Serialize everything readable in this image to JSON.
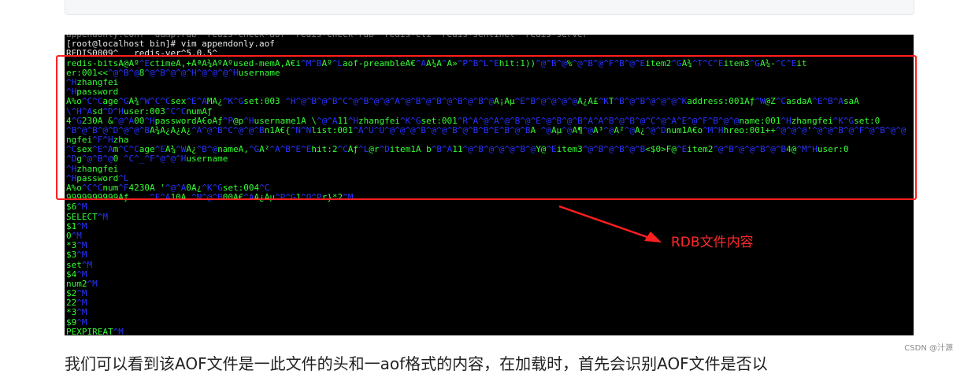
{
  "terminal": {
    "lines": [
      [
        {
          "t": "appendonly.conf  dump.rdb  redis-check-aof  redis-check-rdb  redis-cli  redis-sentinel  redis-server",
          "c": "dim"
        }
      ],
      [
        {
          "t": "[root@localhost bin]# vim appendonly.aof",
          "c": "w"
        }
      ],
      [
        {
          "t": "REDIS0009^   redis-ver^5.0.5^",
          "c": "w"
        }
      ],
      [
        {
          "t": "redis-bitsÃ@Ãº",
          "c": "g"
        },
        {
          "t": "^E",
          "c": "b"
        },
        {
          "t": "ctimeÃ,+ÀªÃ¾ÃºÃºused-memÃ,Ã€i",
          "c": "g"
        },
        {
          "t": "^M^B",
          "c": "b"
        },
        {
          "t": "Ãº",
          "c": "g"
        },
        {
          "t": "^L",
          "c": "b"
        },
        {
          "t": "aof-preambleÃ€",
          "c": "g"
        },
        {
          "t": "^A",
          "c": "b"
        },
        {
          "t": "Ã¾Ã",
          "c": "g"
        },
        {
          "t": "^",
          "c": "b"
        },
        {
          "t": "Ã»",
          "c": "g"
        },
        {
          "t": "^P^B^L^E",
          "c": "b"
        },
        {
          "t": "hit:1))",
          "c": "g"
        },
        {
          "t": "^@^B^@",
          "c": "b"
        },
        {
          "t": "%",
          "c": "g"
        },
        {
          "t": "^@^B^@^F^B^@^E",
          "c": "b"
        },
        {
          "t": "item2",
          "c": "g"
        },
        {
          "t": "^G",
          "c": "b"
        },
        {
          "t": "Ã¾",
          "c": "g"
        },
        {
          "t": "^T^C^E",
          "c": "b"
        },
        {
          "t": "item3",
          "c": "g"
        },
        {
          "t": "^G",
          "c": "b"
        },
        {
          "t": "Ã¾-",
          "c": "g"
        },
        {
          "t": "^C^E",
          "c": "b"
        },
        {
          "t": "it",
          "c": "g"
        }
      ],
      [
        {
          "t": "er:001<<",
          "c": "g"
        },
        {
          "t": "^@^B^@",
          "c": "b"
        },
        {
          "t": "8",
          "c": "g"
        },
        {
          "t": "^@^B^@^@^H^@^@^@^H",
          "c": "b"
        },
        {
          "t": "username",
          "c": "g"
        }
      ],
      [
        {
          "t": "^H",
          "c": "b"
        },
        {
          "t": "zhangfei",
          "c": "g"
        }
      ],
      [
        {
          "t": "^H",
          "c": "b"
        },
        {
          "t": "password",
          "c": "g"
        }
      ],
      [
        {
          "t": "Ã%o",
          "c": "g"
        },
        {
          "t": "^C^C",
          "c": "b"
        },
        {
          "t": "age",
          "c": "g"
        },
        {
          "t": "^G",
          "c": "b"
        },
        {
          "t": "Ã¾",
          "c": "g"
        },
        {
          "t": "^W^C^C",
          "c": "b"
        },
        {
          "t": "sex",
          "c": "g"
        },
        {
          "t": "^E^A",
          "c": "b"
        },
        {
          "t": "MÃ¿",
          "c": "g"
        },
        {
          "t": "^K^G",
          "c": "b"
        },
        {
          "t": "set:003",
          "c": "g"
        },
        {
          "t": " ^H^@^B^@^B^C^@^B^@^@^A^@^B^@^B^@^B^@^B^@",
          "c": "b"
        },
        {
          "t": "Ã¡Ãµ",
          "c": "g"
        },
        {
          "t": "^E^B^@^@^@^@",
          "c": "b"
        },
        {
          "t": "Ã¿Ã£",
          "c": "g"
        },
        {
          "t": "^K",
          "c": "b"
        },
        {
          "t": "T",
          "c": "g"
        },
        {
          "t": "^B^@^B^@^@^@^K",
          "c": "b"
        },
        {
          "t": "address:001Ãƒ",
          "c": "g"
        },
        {
          "t": "^W",
          "c": "b"
        },
        {
          "t": "@Z",
          "c": "g"
        },
        {
          "t": "^C",
          "c": "b"
        },
        {
          "t": "asdaÃ",
          "c": "g"
        },
        {
          "t": "^E^B^A",
          "c": "b"
        },
        {
          "t": "saÃ",
          "c": "g"
        }
      ],
      [
        {
          "t": "\\^H^A",
          "c": "b"
        },
        {
          "t": "sd",
          "c": "g"
        },
        {
          "t": "^D^H",
          "c": "b"
        },
        {
          "t": "user:003",
          "c": "g"
        },
        {
          "t": "^C^C",
          "c": "b"
        },
        {
          "t": "numÃƒ",
          "c": "g"
        }
      ],
      [
        {
          "t": "4",
          "c": "g"
        },
        {
          "t": "^G",
          "c": "b"
        },
        {
          "t": "230Ã &",
          "c": "g"
        },
        {
          "t": "^@^A",
          "c": "b"
        },
        {
          "t": "00",
          "c": "g"
        },
        {
          "t": "^H",
          "c": "b"
        },
        {
          "t": "passwordÃ€oÃƒ",
          "c": "g"
        },
        {
          "t": "^P",
          "c": "b"
        },
        {
          "t": "@p",
          "c": "g"
        },
        {
          "t": "^H",
          "c": "b"
        },
        {
          "t": "username1Ã \\",
          "c": "g"
        },
        {
          "t": "^@^A",
          "c": "b"
        },
        {
          "t": "11",
          "c": "g"
        },
        {
          "t": "^H",
          "c": "b"
        },
        {
          "t": "zhangfei",
          "c": "g"
        },
        {
          "t": "^K^G",
          "c": "b"
        },
        {
          "t": "set:001",
          "c": "g"
        },
        {
          "t": "^R^A^@^A^@^B^@^E^@^B^@^B^A^A^B^@^B^@^C^@^A^E^@^F^B^@^@",
          "c": "b"
        },
        {
          "t": "name:001",
          "c": "g"
        },
        {
          "t": "^H",
          "c": "b"
        },
        {
          "t": "zhangfei",
          "c": "g"
        },
        {
          "t": "^K^G",
          "c": "b"
        },
        {
          "t": "set:0",
          "c": "g"
        }
      ],
      [
        {
          "t": "^B^@^B^@^D^@^@^B",
          "c": "b"
        },
        {
          "t": "Ã¾Ã¿Ã¿Ã¿",
          "c": "g"
        },
        {
          "t": "^A^@^B^C^@^@^B",
          "c": "b"
        },
        {
          "t": "n1Ã€{",
          "c": "g"
        },
        {
          "t": "^N^N",
          "c": "b"
        },
        {
          "t": "list:001",
          "c": "g"
        },
        {
          "t": "^A^U^U^@^@^@^B^@^@^B^@^B^B^E^B^@^B",
          "c": "b"
        },
        {
          "t": "Ã ",
          "c": "g"
        },
        {
          "t": "^@",
          "c": "b"
        },
        {
          "t": "Ãµ",
          "c": "g"
        },
        {
          "t": "^@",
          "c": "b"
        },
        {
          "t": "Ã¶",
          "c": "g"
        },
        {
          "t": "^@",
          "c": "b"
        },
        {
          "t": "Ã³",
          "c": "g"
        },
        {
          "t": "^@",
          "c": "b"
        },
        {
          "t": "Ã²",
          "c": "g"
        },
        {
          "t": "^@",
          "c": "b"
        },
        {
          "t": "Ã¿",
          "c": "g"
        },
        {
          "t": "^@^D",
          "c": "b"
        },
        {
          "t": "num1Ã€o",
          "c": "g"
        },
        {
          "t": "^M^H",
          "c": "b"
        },
        {
          "t": "hreo:001++",
          "c": "g"
        },
        {
          "t": "^@^@^@",
          "c": "b"
        },
        {
          "t": "'",
          "c": "g"
        },
        {
          "t": "^@^@^B^@^F^@^B^@^@",
          "c": "b"
        }
      ],
      [
        {
          "t": "ngfei",
          "c": "g"
        },
        {
          "t": "^F^H",
          "c": "b"
        },
        {
          "t": "zha",
          "c": "g"
        }
      ],
      [
        {
          "t": "^C",
          "c": "b"
        },
        {
          "t": "sex",
          "c": "g"
        },
        {
          "t": "^E^A",
          "c": "b"
        },
        {
          "t": "m",
          "c": "g"
        },
        {
          "t": "^C^C",
          "c": "b"
        },
        {
          "t": "age",
          "c": "g"
        },
        {
          "t": "^E",
          "c": "b"
        },
        {
          "t": "Ã¾",
          "c": "g"
        },
        {
          "t": "^W",
          "c": "b"
        },
        {
          "t": "Ã¿",
          "c": "g"
        },
        {
          "t": "^B^@",
          "c": "b"
        },
        {
          "t": "nameÃ,",
          "c": "g"
        },
        {
          "t": "^G",
          "c": "b"
        },
        {
          "t": "Ã²",
          "c": "g"
        },
        {
          "t": "^A^B^E^E",
          "c": "b"
        },
        {
          "t": "hit:2",
          "c": "g"
        },
        {
          "t": "^C",
          "c": "b"
        },
        {
          "t": "Ãƒ",
          "c": "g"
        },
        {
          "t": "^L",
          "c": "b"
        },
        {
          "t": "@r",
          "c": "g"
        },
        {
          "t": "^D",
          "c": "b"
        },
        {
          "t": "item1Ã b",
          "c": "g"
        },
        {
          "t": "^B^A",
          "c": "b"
        },
        {
          "t": "11",
          "c": "g"
        },
        {
          "t": "^@^B^@^@^@^B^@",
          "c": "b"
        },
        {
          "t": "Y@",
          "c": "g"
        },
        {
          "t": "^E",
          "c": "b"
        },
        {
          "t": "item3",
          "c": "g"
        },
        {
          "t": "^@^B^@^B^@^B",
          "c": "b"
        },
        {
          "t": "<$0>F@",
          "c": "g"
        },
        {
          "t": "^E",
          "c": "b"
        },
        {
          "t": "item2",
          "c": "g"
        },
        {
          "t": "^@^B^@^@^B^@^B",
          "c": "b"
        },
        {
          "t": "4@",
          "c": "g"
        },
        {
          "t": "^M^H",
          "c": "b"
        },
        {
          "t": "user:0",
          "c": "g"
        }
      ],
      [
        {
          "t": "^D",
          "c": "b"
        },
        {
          "t": "g",
          "c": "g"
        },
        {
          "t": "^@^B^@",
          "c": "b"
        },
        {
          "t": "0 ",
          "c": "g"
        },
        {
          "t": "^C^_^F^@^@^H",
          "c": "b"
        },
        {
          "t": "username",
          "c": "g"
        }
      ],
      [
        {
          "t": "^H",
          "c": "b"
        },
        {
          "t": "zhangfei",
          "c": "g"
        }
      ],
      [
        {
          "t": "^H",
          "c": "b"
        },
        {
          "t": "password",
          "c": "g"
        },
        {
          "t": "^L",
          "c": "b"
        }
      ],
      [
        {
          "t": "Ã%o",
          "c": "g"
        },
        {
          "t": "^C^C",
          "c": "b"
        },
        {
          "t": "num",
          "c": "g"
        },
        {
          "t": "^F",
          "c": "b"
        },
        {
          "t": "4230Ã '",
          "c": "g"
        },
        {
          "t": "^@^A",
          "c": "b"
        },
        {
          "t": "0Ã¿",
          "c": "g"
        },
        {
          "t": "^K^G",
          "c": "b"
        },
        {
          "t": "set:004",
          "c": "g"
        },
        {
          "t": "^C",
          "c": "b"
        }
      ],
      [
        {
          "t": "9999999999Ãƒ",
          "c": "g"
        },
        {
          "t": "    ^F^A",
          "c": "b"
        },
        {
          "t": "10Ã ",
          "c": "g"
        },
        {
          "t": "^N^@^B",
          "c": "b"
        },
        {
          "t": "00Ã€",
          "c": "g"
        },
        {
          "t": "^A",
          "c": "b"
        },
        {
          "t": "Ã¿Ãµ",
          "c": "g"
        },
        {
          "t": "^P^G",
          "c": "b"
        },
        {
          "t": "1",
          "c": "g"
        },
        {
          "t": "^O^P",
          "c": "b"
        },
        {
          "t": "r}*2",
          "c": "g"
        },
        {
          "t": "^M",
          "c": "b"
        }
      ],
      [
        {
          "t": "$6",
          "c": "g"
        },
        {
          "t": "^M",
          "c": "b"
        }
      ],
      [
        {
          "t": "SELECT",
          "c": "g"
        },
        {
          "t": "^M",
          "c": "b"
        }
      ],
      [
        {
          "t": "$1",
          "c": "g"
        },
        {
          "t": "^M",
          "c": "b"
        }
      ],
      [
        {
          "t": "0",
          "c": "g"
        },
        {
          "t": "^M",
          "c": "b"
        }
      ],
      [
        {
          "t": "*3",
          "c": "g"
        },
        {
          "t": "^M",
          "c": "b"
        }
      ],
      [
        {
          "t": "$3",
          "c": "g"
        },
        {
          "t": "^M",
          "c": "b"
        }
      ],
      [
        {
          "t": "set",
          "c": "g"
        },
        {
          "t": "^M",
          "c": "b"
        }
      ],
      [
        {
          "t": "$4",
          "c": "g"
        },
        {
          "t": "^M",
          "c": "b"
        }
      ],
      [
        {
          "t": "num2",
          "c": "g"
        },
        {
          "t": "^M",
          "c": "b"
        }
      ],
      [
        {
          "t": "$2",
          "c": "g"
        },
        {
          "t": "^M",
          "c": "b"
        }
      ],
      [
        {
          "t": "22",
          "c": "g"
        },
        {
          "t": "^M",
          "c": "b"
        }
      ],
      [
        {
          "t": "*3",
          "c": "g"
        },
        {
          "t": "^M",
          "c": "b"
        }
      ],
      [
        {
          "t": "$9",
          "c": "g"
        },
        {
          "t": "^M",
          "c": "b"
        }
      ],
      [
        {
          "t": "PEXPIREAT",
          "c": "g"
        },
        {
          "t": "^M",
          "c": "b"
        }
      ]
    ]
  },
  "annotation": {
    "label": "RDB文件内容",
    "color": "#ff2a2a"
  },
  "article": {
    "partial_text": "我们可以看到该AOF文件是一此文件的头和一aof格式的内容，在加载时，首先会识别AOF文件是否以"
  },
  "watermark": "CSDN @汁源"
}
